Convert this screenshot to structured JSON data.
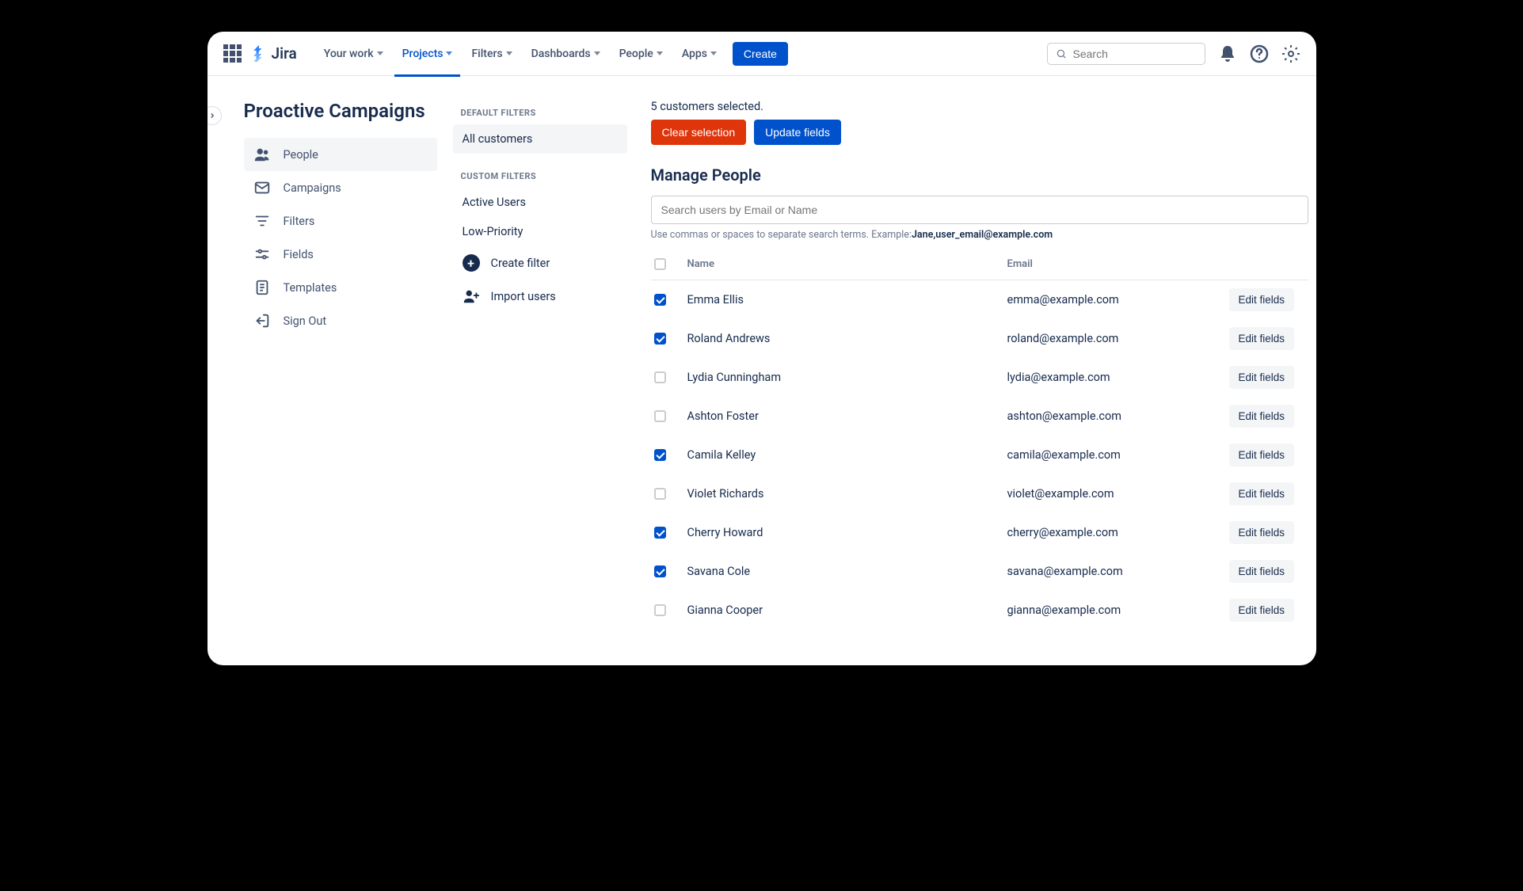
{
  "header": {
    "product": "Jira",
    "nav": [
      "Your work",
      "Projects",
      "Filters",
      "Dashboards",
      "People",
      "Apps"
    ],
    "active_index": 1,
    "create_label": "Create",
    "search_placeholder": "Search"
  },
  "page_title": "Proactive Campaigns",
  "sidebar": {
    "items": [
      {
        "label": "People",
        "icon": "people-icon"
      },
      {
        "label": "Campaigns",
        "icon": "envelope-icon"
      },
      {
        "label": "Filters",
        "icon": "filter-icon"
      },
      {
        "label": "Fields",
        "icon": "sliders-icon"
      },
      {
        "label": "Templates",
        "icon": "template-icon"
      },
      {
        "label": "Sign Out",
        "icon": "signout-icon"
      }
    ],
    "selected_index": 0
  },
  "filters": {
    "default_heading": "DEFAULT FILTERS",
    "default_items": [
      "All customers"
    ],
    "default_selected": 0,
    "custom_heading": "CUSTOM FILTERS",
    "custom_items": [
      "Active Users",
      "Low-Priority"
    ],
    "create_label": "Create filter",
    "import_label": "Import users"
  },
  "main": {
    "selection_text": "5 customers selected.",
    "clear_label": "Clear selection",
    "update_label": "Update fields",
    "title": "Manage People",
    "search_placeholder": "Search users by Email or Name",
    "hint_prefix": "Use commas or spaces to separate search terms. Example:",
    "hint_bold": "Jane,user_email@example.com",
    "columns": {
      "name": "Name",
      "email": "Email"
    },
    "edit_label": "Edit fields",
    "rows": [
      {
        "name": "Emma Ellis",
        "email": "emma@example.com",
        "checked": true
      },
      {
        "name": "Roland Andrews",
        "email": "roland@example.com",
        "checked": true
      },
      {
        "name": "Lydia Cunningham",
        "email": "lydia@example.com",
        "checked": false
      },
      {
        "name": "Ashton Foster",
        "email": "ashton@example.com",
        "checked": false
      },
      {
        "name": "Camila Kelley",
        "email": "camila@example.com",
        "checked": true
      },
      {
        "name": "Violet Richards",
        "email": "violet@example.com",
        "checked": false
      },
      {
        "name": "Cherry Howard",
        "email": "cherry@example.com",
        "checked": true
      },
      {
        "name": "Savana Cole",
        "email": "savana@example.com",
        "checked": true
      },
      {
        "name": "Gianna Cooper",
        "email": "gianna@example.com",
        "checked": false
      }
    ]
  }
}
